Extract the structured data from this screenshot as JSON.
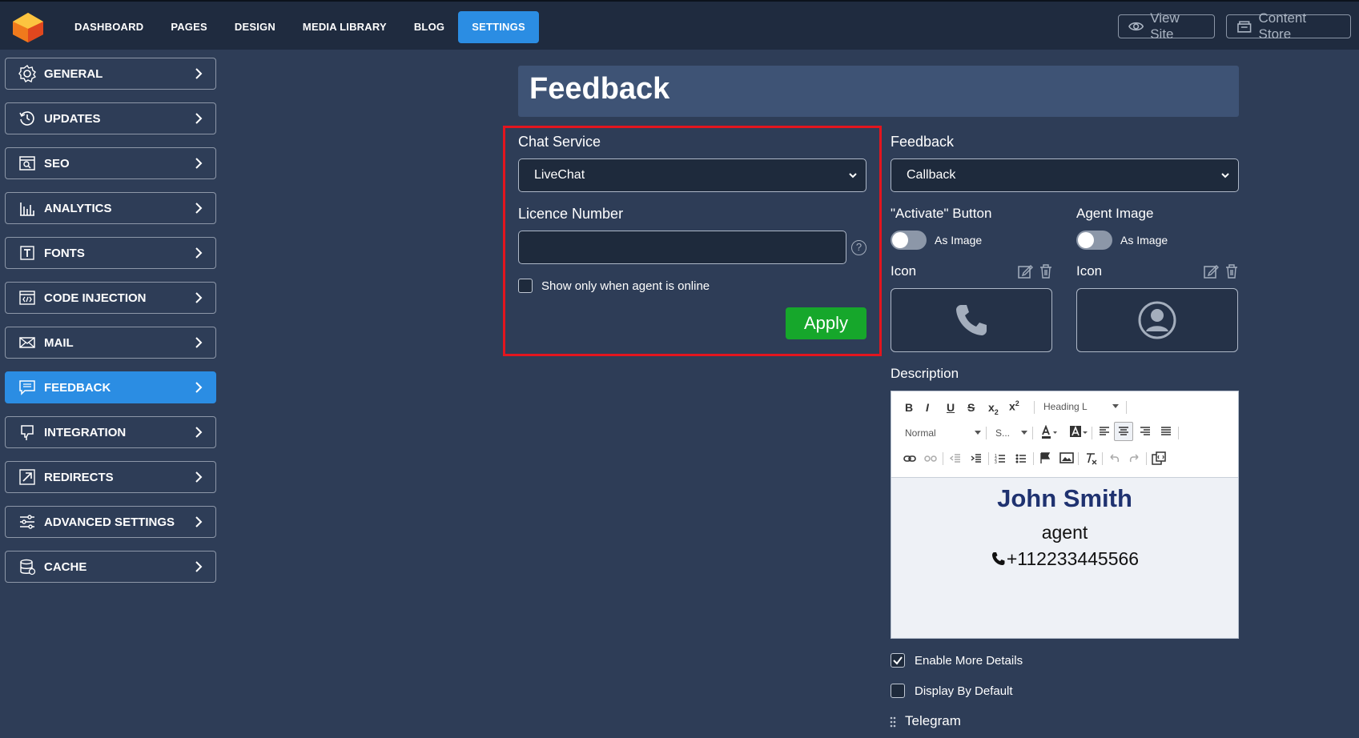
{
  "nav": {
    "items": [
      {
        "label": "DASHBOARD",
        "active": false
      },
      {
        "label": "PAGES",
        "active": false
      },
      {
        "label": "DESIGN",
        "active": false
      },
      {
        "label": "MEDIA LIBRARY",
        "active": false
      },
      {
        "label": "BLOG",
        "active": false
      },
      {
        "label": "SETTINGS",
        "active": true
      }
    ],
    "view_site": "View Site",
    "content_store": "Content Store"
  },
  "sidebar": {
    "items": [
      {
        "label": "GENERAL",
        "icon": "gear-icon"
      },
      {
        "label": "UPDATES",
        "icon": "history-icon"
      },
      {
        "label": "SEO",
        "icon": "seo-icon"
      },
      {
        "label": "ANALYTICS",
        "icon": "analytics-icon"
      },
      {
        "label": "FONTS",
        "icon": "fonts-icon"
      },
      {
        "label": "CODE INJECTION",
        "icon": "code-icon"
      },
      {
        "label": "MAIL",
        "icon": "mail-icon"
      },
      {
        "label": "FEEDBACK",
        "icon": "feedback-icon",
        "active": true
      },
      {
        "label": "INTEGRATION",
        "icon": "integration-icon"
      },
      {
        "label": "REDIRECTS",
        "icon": "redirect-icon"
      },
      {
        "label": "ADVANCED SETTINGS",
        "icon": "sliders-icon"
      },
      {
        "label": "CACHE",
        "icon": "database-icon"
      }
    ]
  },
  "page": {
    "title": "Feedback"
  },
  "chat": {
    "service_label": "Chat Service",
    "service_value": "LiveChat",
    "licence_label": "Licence Number",
    "licence_value": "",
    "help_glyph": "?",
    "online_only_label": "Show only when agent is online",
    "online_only_checked": false,
    "apply_label": "Apply"
  },
  "feedback": {
    "label": "Feedback",
    "value": "Callback",
    "activate_button_label": "\"Activate\" Button",
    "activate_toggle_label": "As Image",
    "agent_image_label": "Agent Image",
    "agent_toggle_label": "As Image",
    "icon_label_left": "Icon",
    "icon_label_right": "Icon",
    "description_label": "Description",
    "enable_more_label": "Enable More Details",
    "enable_more_checked": true,
    "display_default_label": "Display By Default",
    "display_default_checked": false,
    "telegram_label": "Telegram"
  },
  "editor": {
    "heading_select": "Heading L",
    "format_select": "Normal",
    "size_select": "S...",
    "agent_name": "John Smith",
    "agent_role": "agent",
    "agent_phone": "+112233445566"
  },
  "colors": {
    "accent": "#2b8de3",
    "apply": "#16a72b",
    "highlight_border": "#e3151e",
    "background": "#2e3d57"
  }
}
